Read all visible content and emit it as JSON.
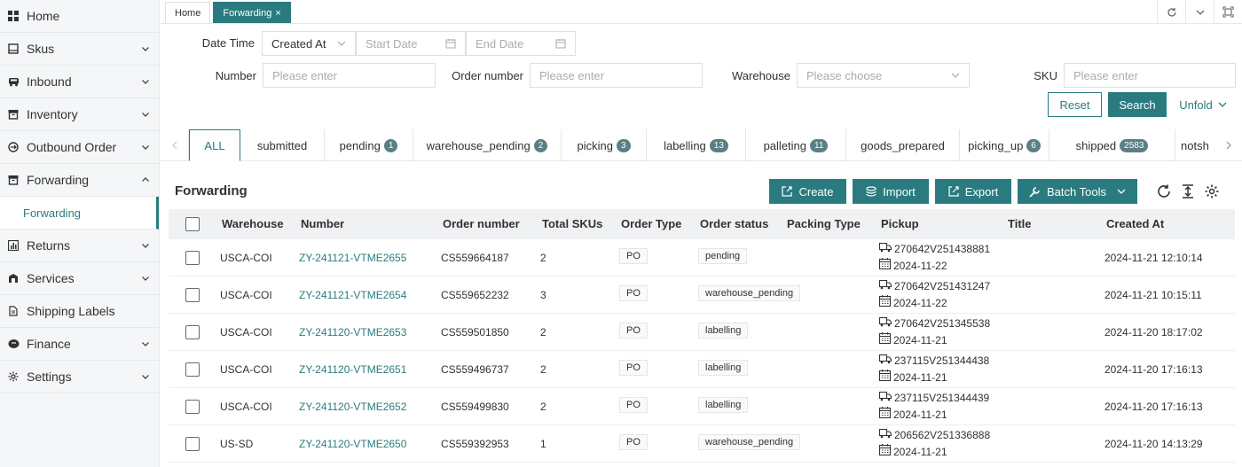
{
  "sidebar": {
    "items": [
      {
        "label": "Home",
        "icon": "grid-icon",
        "chevron": false
      },
      {
        "label": "Skus",
        "icon": "box-icon",
        "chevron": true
      },
      {
        "label": "Inbound",
        "icon": "truck-icon",
        "chevron": true
      },
      {
        "label": "Inventory",
        "icon": "archive-icon",
        "chevron": true
      },
      {
        "label": "Outbound Order",
        "icon": "circle-arrow-icon",
        "chevron": true
      },
      {
        "label": "Forwarding",
        "icon": "archive-icon",
        "chevron": "up"
      },
      {
        "label": "Returns",
        "icon": "chart-icon",
        "chevron": true
      },
      {
        "label": "Services",
        "icon": "building-icon",
        "chevron": true
      },
      {
        "label": "Shipping Labels",
        "icon": "document-icon",
        "chevron": false
      },
      {
        "label": "Finance",
        "icon": "coins-icon",
        "chevron": true
      },
      {
        "label": "Settings",
        "icon": "gear-icon",
        "chevron": true
      }
    ],
    "subitem": "Forwarding"
  },
  "tabs": {
    "home": "Home",
    "active": "Forwarding",
    "close": "×"
  },
  "filters": {
    "date_time_label": "Date Time",
    "date_type": "Created At",
    "start_placeholder": "Start Date",
    "end_placeholder": "End Date",
    "number_label": "Number",
    "number_placeholder": "Please enter",
    "order_label": "Order number",
    "order_placeholder": "Please enter",
    "warehouse_label": "Warehouse",
    "warehouse_placeholder": "Please choose",
    "sku_label": "SKU",
    "sku_placeholder": "Please enter",
    "reset": "Reset",
    "search": "Search",
    "unfold": "Unfold"
  },
  "status_tabs": [
    {
      "label": "ALL",
      "count": null
    },
    {
      "label": "submitted",
      "count": null
    },
    {
      "label": "pending",
      "count": "1"
    },
    {
      "label": "warehouse_pending",
      "count": "2"
    },
    {
      "label": "picking",
      "count": "3"
    },
    {
      "label": "labelling",
      "count": "13"
    },
    {
      "label": "palleting",
      "count": "11"
    },
    {
      "label": "goods_prepared",
      "count": null
    },
    {
      "label": "picking_up",
      "count": "6"
    },
    {
      "label": "shipped",
      "count": "2583"
    },
    {
      "label": "notsh",
      "count": null
    }
  ],
  "toolbar": {
    "title": "Forwarding",
    "create": "Create",
    "import": "Import",
    "export": "Export",
    "batch": "Batch Tools"
  },
  "table": {
    "headers": [
      "Warehouse",
      "Number",
      "Order number",
      "Total SKUs",
      "Order Type",
      "Order status",
      "Packing Type",
      "Pickup",
      "Title",
      "Created At"
    ],
    "rows": [
      {
        "warehouse": "USCA-COI",
        "number": "ZY-241121-VTME2655",
        "order": "CS559664187",
        "skus": "2",
        "type": "PO",
        "status": "pending",
        "pickup_id": "270642V251438881",
        "pickup_date": "2024-11-22",
        "created": "2024-11-21 12:10:14"
      },
      {
        "warehouse": "USCA-COI",
        "number": "ZY-241121-VTME2654",
        "order": "CS559652232",
        "skus": "3",
        "type": "PO",
        "status": "warehouse_pending",
        "pickup_id": "270642V251431247",
        "pickup_date": "2024-11-22",
        "created": "2024-11-21 10:15:11"
      },
      {
        "warehouse": "USCA-COI",
        "number": "ZY-241120-VTME2653",
        "order": "CS559501850",
        "skus": "2",
        "type": "PO",
        "status": "labelling",
        "pickup_id": "270642V251345538",
        "pickup_date": "2024-11-21",
        "created": "2024-11-20 18:17:02"
      },
      {
        "warehouse": "USCA-COI",
        "number": "ZY-241120-VTME2651",
        "order": "CS559496737",
        "skus": "2",
        "type": "PO",
        "status": "labelling",
        "pickup_id": "237115V251344438",
        "pickup_date": "2024-11-21",
        "created": "2024-11-20 17:16:13"
      },
      {
        "warehouse": "USCA-COI",
        "number": "ZY-241120-VTME2652",
        "order": "CS559499830",
        "skus": "2",
        "type": "PO",
        "status": "labelling",
        "pickup_id": "237115V251344439",
        "pickup_date": "2024-11-21",
        "created": "2024-11-20 17:16:13"
      },
      {
        "warehouse": "US-SD",
        "number": "ZY-241120-VTME2650",
        "order": "CS559392953",
        "skus": "1",
        "type": "PO",
        "status": "warehouse_pending",
        "pickup_id": "206562V251336888",
        "pickup_date": "2024-11-21",
        "created": "2024-11-20 14:13:29"
      }
    ]
  },
  "colors": {
    "accent": "#2a7b7f",
    "badge": "#5a7f84"
  }
}
